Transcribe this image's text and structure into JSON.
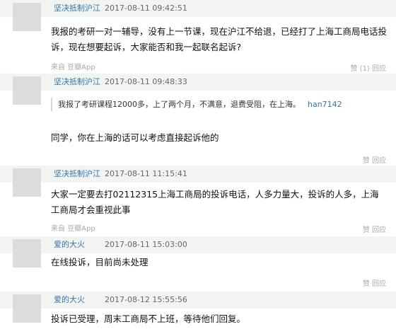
{
  "comments": [
    {
      "author": "坚决抵制沪江",
      "time": "2017-08-11 09:42:51",
      "text": "我报的考研一对一辅导，没有上一节课，现在沪江不给退，已经打了上海工商局电话投诉，现在想要起诉，大家能否和我一起联名起诉?",
      "source": "来自 豆瓣App",
      "likes": "赞 (1)  回应"
    },
    {
      "author": "坚决抵制沪江",
      "time": "2017-08-11 09:48:33",
      "quote_text": "我报了考研课程12000多，上了两个月，不满意，退费受阻，在上海。",
      "quote_author": "han7142",
      "text": "同学，你在上海的话可以考虑直接起诉他的",
      "likes": "赞  回应"
    },
    {
      "author": "坚决抵制沪江",
      "time": "2017-08-11 11:15:41",
      "text": "大家一定要去打02112315上海工商局的投诉电话，人多力量大，投诉的人多，上海工商局才会重视此事",
      "source": "来自 豆瓣App",
      "likes": "赞  回应"
    },
    {
      "author": "爱的大火",
      "time": "2017-08-11 15:03:00",
      "text": "在线投诉，目前尚未处理",
      "likes": "赞  回应"
    },
    {
      "author": "爱的大火",
      "time": "2017-08-12 15:55:56",
      "text": "投诉已受理，周末工商局不上班，等待他们回复。"
    }
  ]
}
